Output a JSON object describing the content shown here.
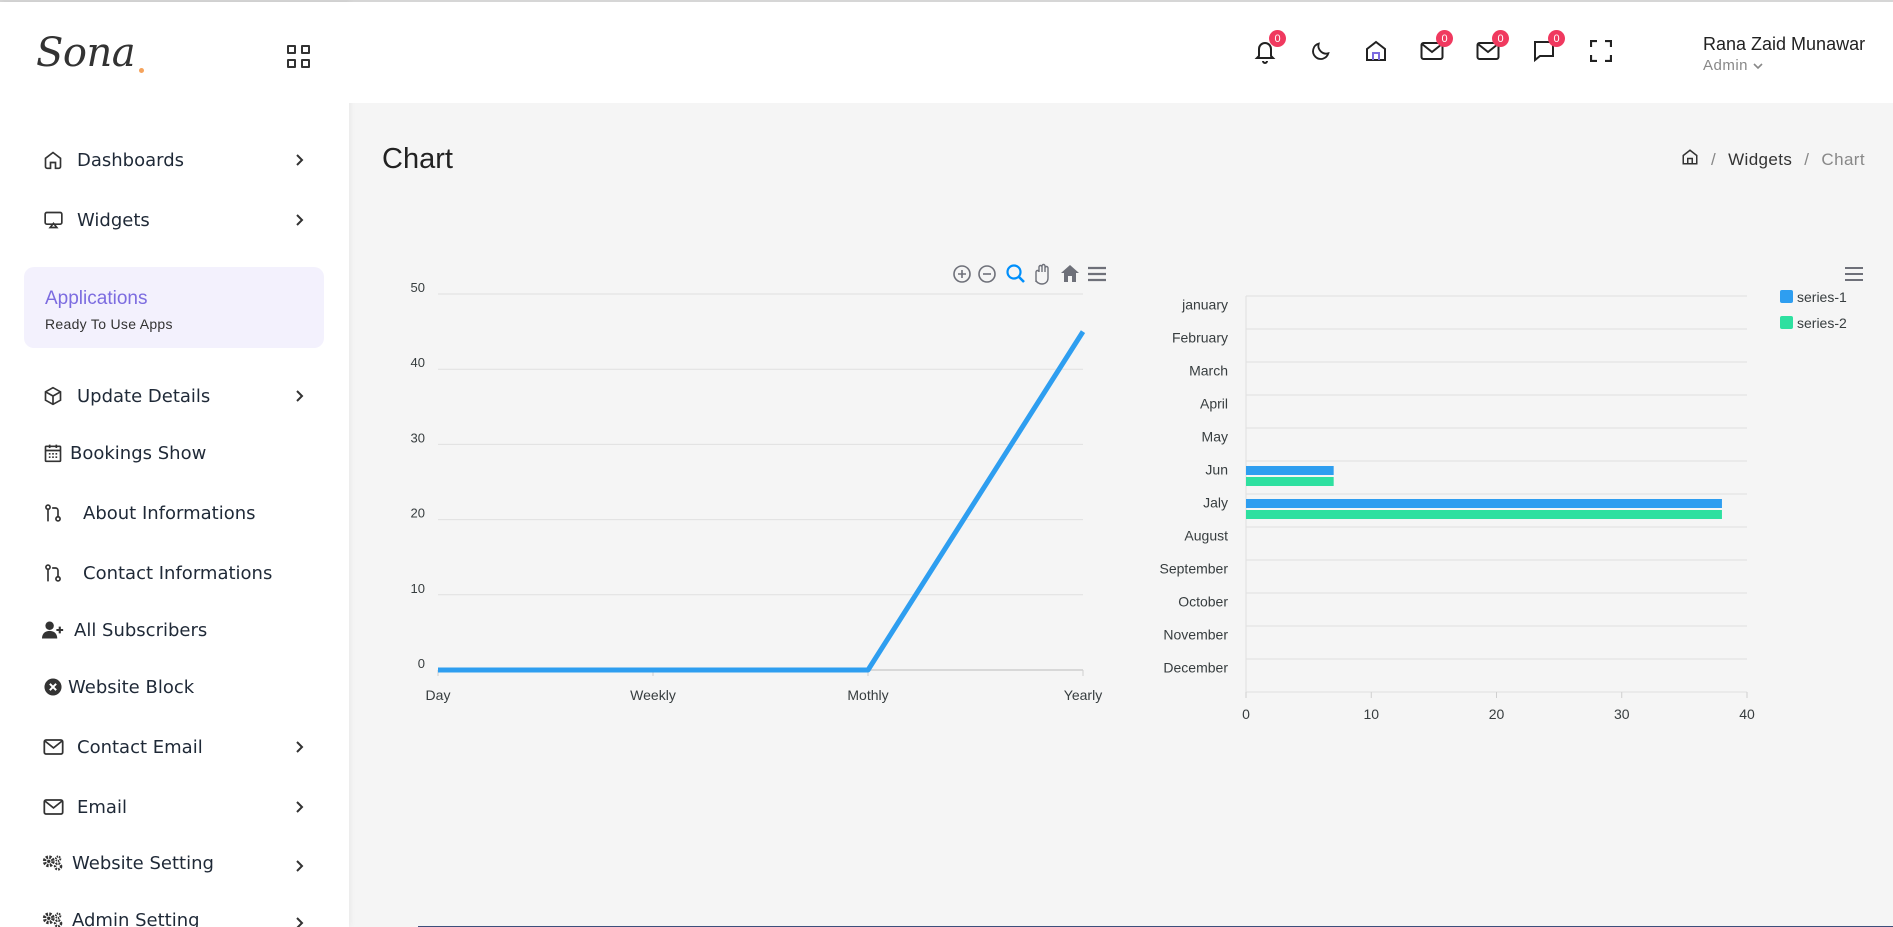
{
  "brand": {
    "logo_text": "Sona"
  },
  "sidebar": {
    "items": [
      {
        "label": "Dashboards",
        "icon": "home-icon",
        "chevron": true
      },
      {
        "label": "Widgets",
        "icon": "cast-icon",
        "chevron": true
      },
      {
        "label": "Update Details",
        "icon": "box-icon",
        "chevron": true
      },
      {
        "label": "Bookings Show",
        "icon": "calendar-icon",
        "chevron": false
      },
      {
        "label": "About Informations",
        "icon": "git-pull-icon",
        "chevron": false
      },
      {
        "label": "Contact Informations",
        "icon": "git-pull-icon",
        "chevron": false
      },
      {
        "label": "All Subscribers",
        "icon": "user-plus-icon",
        "chevron": false
      },
      {
        "label": "Website Block",
        "icon": "circle-x-icon",
        "chevron": false
      },
      {
        "label": "Contact Email",
        "icon": "mail-icon",
        "chevron": true
      },
      {
        "label": "Email",
        "icon": "mail-icon",
        "chevron": true
      },
      {
        "label": "Website Setting",
        "icon": "gears-icon",
        "chevron": true
      },
      {
        "label": "Admin Setting",
        "icon": "gears-icon",
        "chevron": true
      }
    ],
    "apps_box": {
      "title": "Applications",
      "subtitle": "Ready To Use Apps"
    }
  },
  "header": {
    "badges": [
      "0",
      "0",
      "0",
      "0"
    ],
    "user_name": "Rana Zaid Munawar",
    "user_role": "Admin"
  },
  "page": {
    "title": "Chart",
    "breadcrumb": {
      "section": "Widgets",
      "current": "Chart"
    }
  },
  "colors": {
    "accent": "#7c6ce0",
    "series1": "#2e9ef0",
    "series2": "#2ee0a0",
    "badge": "#f0395f"
  },
  "chart_data": [
    {
      "type": "line",
      "x": [
        "Day",
        "Weekly",
        "Mothly",
        "Yearly"
      ],
      "series": [
        {
          "values": [
            0,
            0,
            0,
            45
          ]
        }
      ],
      "ylim": [
        0,
        50
      ],
      "yticks": [
        0,
        10,
        20,
        30,
        40,
        50
      ],
      "grid": true,
      "toolbar": [
        "zoom-in-icon",
        "zoom-out-icon",
        "magnify-icon",
        "pan-hand-icon",
        "reset-home-icon",
        "menu-icon"
      ]
    },
    {
      "type": "bar",
      "orientation": "horizontal",
      "categories": [
        "january",
        "February",
        "March",
        "April",
        "May",
        "Jun",
        "Jaly",
        "August",
        "September",
        "October",
        "November",
        "December"
      ],
      "series": [
        {
          "name": "series-1",
          "values": [
            0,
            0,
            0,
            0,
            0,
            7,
            38,
            0,
            0,
            0,
            0,
            0
          ]
        },
        {
          "name": "series-2",
          "values": [
            0,
            0,
            0,
            0,
            0,
            7,
            38,
            0,
            0,
            0,
            0,
            0
          ]
        }
      ],
      "xlim": [
        0,
        40
      ],
      "xticks": [
        0,
        10,
        20,
        30,
        40
      ],
      "legend": "top-right",
      "grid": true
    }
  ]
}
